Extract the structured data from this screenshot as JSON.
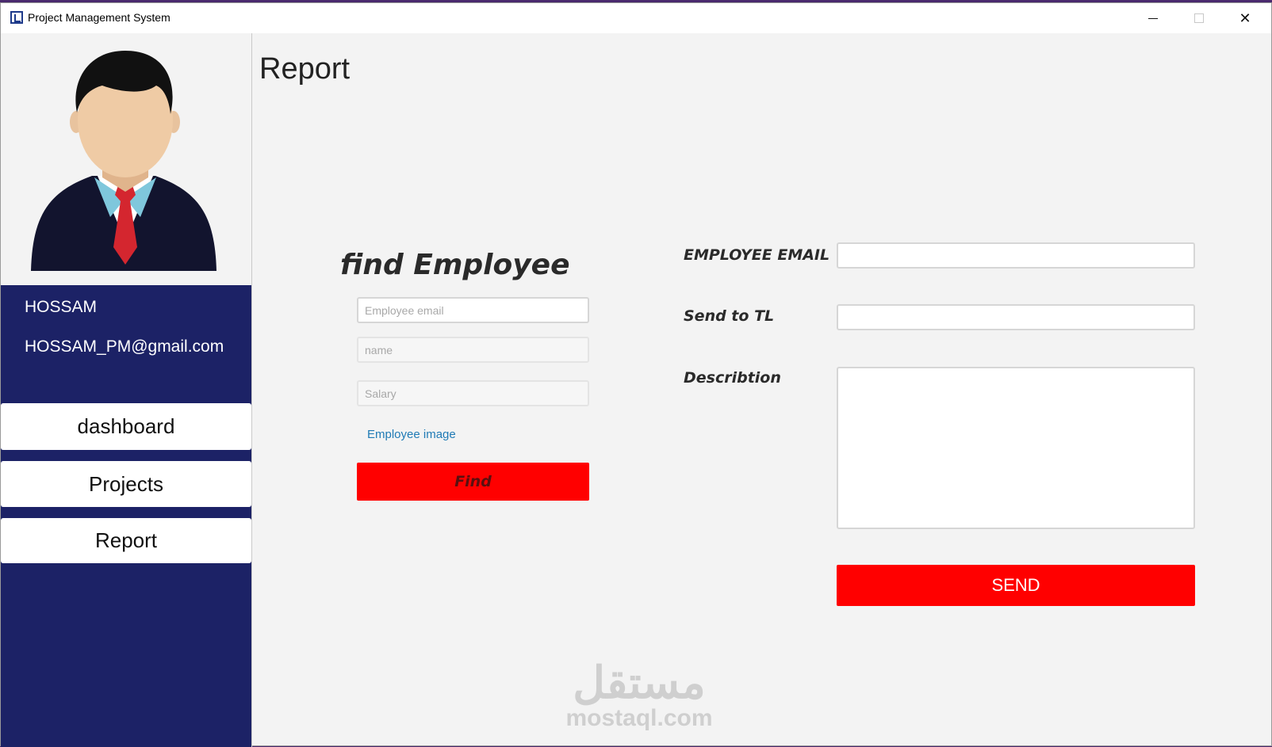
{
  "window": {
    "title": "Project Management System",
    "minimize_icon": "minimize-icon",
    "maximize_icon": "maximize-icon",
    "close_icon": "close-icon",
    "close_glyph": "✕"
  },
  "sidebar": {
    "user_name": "HOSSAM",
    "user_email": "HOSSAM_PM@gmail.com",
    "items": [
      {
        "label": "dashboard"
      },
      {
        "label": "Projects"
      },
      {
        "label": "Report"
      }
    ],
    "accent_color": "#1c2266"
  },
  "main": {
    "page_title": "Report",
    "find_section": {
      "title": "find Employee",
      "email_placeholder": "Employee email",
      "name_placeholder": "name",
      "salary_placeholder": "Salary",
      "image_link": "Employee image",
      "find_button": "Find"
    },
    "report_form": {
      "employee_email_label": "EMPLOYEE EMAIL",
      "send_to_tl_label": "Send to TL",
      "description_label": "Describtion",
      "send_button": "SEND"
    },
    "button_color": "#ff0000"
  },
  "watermark": {
    "arabic": "مستقل",
    "latin": "mostaql.com"
  }
}
